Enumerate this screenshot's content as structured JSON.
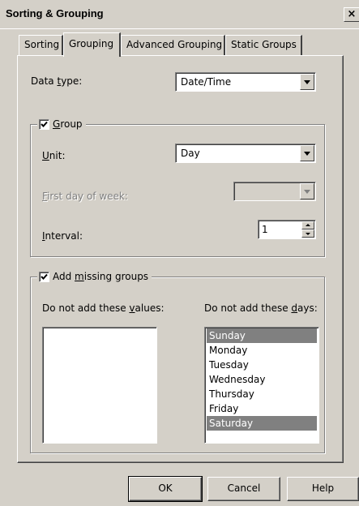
{
  "window": {
    "title": "Sorting & Grouping",
    "close_symbol": "×"
  },
  "tabs": [
    {
      "label": "Sorting",
      "active": false
    },
    {
      "label": "Grouping",
      "active": true
    },
    {
      "label": "Advanced Grouping",
      "active": false
    },
    {
      "label": "Static Groups",
      "active": false
    }
  ],
  "data_type": {
    "label_pre": "Data ",
    "label_u": "t",
    "label_post": "ype:",
    "value": "Date/Time"
  },
  "group": {
    "checked": true,
    "label_u": "G",
    "label_post": "roup",
    "unit": {
      "label_u": "U",
      "label_post": "nit:",
      "value": "Day"
    },
    "first_day": {
      "label_u": "F",
      "label_post": "irst day of week:",
      "value": "",
      "disabled": true
    },
    "interval": {
      "label_u": "I",
      "label_post": "nterval:",
      "value": "1"
    }
  },
  "missing": {
    "checked": true,
    "label_pre": "Add ",
    "label_u": "m",
    "label_post": "issing groups",
    "values_label_pre": "Do not add these ",
    "values_label_u": "v",
    "values_label_post": "alues:",
    "days_label_pre": "Do not add these ",
    "days_label_u": "d",
    "days_label_post": "ays:",
    "values": [],
    "days": [
      {
        "label": "Sunday",
        "selected": true
      },
      {
        "label": "Monday",
        "selected": false
      },
      {
        "label": "Tuesday",
        "selected": false
      },
      {
        "label": "Wednesday",
        "selected": false
      },
      {
        "label": "Thursday",
        "selected": false
      },
      {
        "label": "Friday",
        "selected": false
      },
      {
        "label": "Saturday",
        "selected": true
      }
    ]
  },
  "buttons": {
    "ok": "OK",
    "cancel": "Cancel",
    "help": "Help"
  },
  "colors": {
    "face": "#d4d0c8",
    "selection": "#808080",
    "disabled_text": "#808080"
  }
}
